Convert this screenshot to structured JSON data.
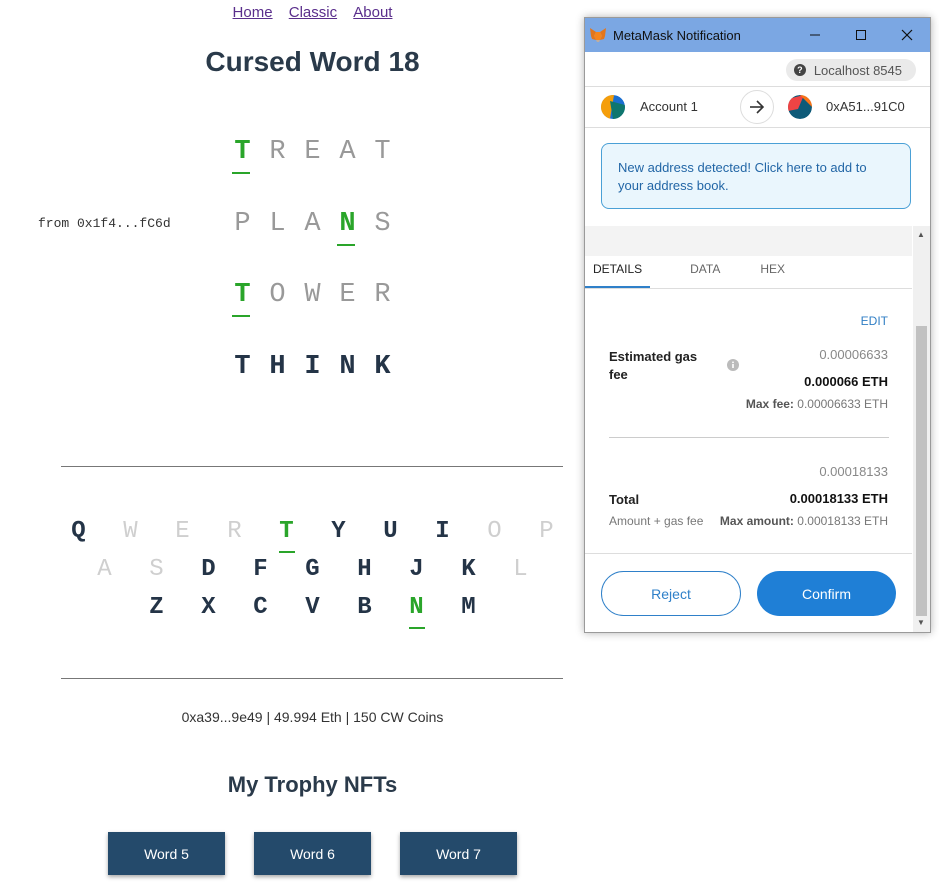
{
  "nav": {
    "home": "Home",
    "classic": "Classic",
    "about": "About"
  },
  "game": {
    "title": "Cursed Word 18",
    "from_label": "from 0x1f4...fC6d",
    "guesses": [
      [
        {
          "l": "T",
          "s": "green"
        },
        {
          "l": "R",
          "s": "gray"
        },
        {
          "l": "E",
          "s": "gray"
        },
        {
          "l": "A",
          "s": "gray"
        },
        {
          "l": "T",
          "s": "gray"
        }
      ],
      [
        {
          "l": "P",
          "s": "gray"
        },
        {
          "l": "L",
          "s": "gray"
        },
        {
          "l": "A",
          "s": "gray"
        },
        {
          "l": "N",
          "s": "green"
        },
        {
          "l": "S",
          "s": "gray"
        }
      ],
      [
        {
          "l": "T",
          "s": "green"
        },
        {
          "l": "O",
          "s": "gray"
        },
        {
          "l": "W",
          "s": "gray"
        },
        {
          "l": "E",
          "s": "gray"
        },
        {
          "l": "R",
          "s": "gray"
        }
      ],
      [
        {
          "l": "T",
          "s": "dark"
        },
        {
          "l": "H",
          "s": "dark"
        },
        {
          "l": "I",
          "s": "dark"
        },
        {
          "l": "N",
          "s": "dark"
        },
        {
          "l": "K",
          "s": "dark"
        }
      ]
    ]
  },
  "keyboard": {
    "rows": [
      [
        {
          "l": "Q",
          "s": "dark"
        },
        {
          "l": "W",
          "s": "gray"
        },
        {
          "l": "E",
          "s": "gray"
        },
        {
          "l": "R",
          "s": "gray"
        },
        {
          "l": "T",
          "s": "green"
        },
        {
          "l": "Y",
          "s": "dark"
        },
        {
          "l": "U",
          "s": "dark"
        },
        {
          "l": "I",
          "s": "dark"
        },
        {
          "l": "O",
          "s": "gray"
        },
        {
          "l": "P",
          "s": "gray"
        }
      ],
      [
        {
          "l": "A",
          "s": "gray"
        },
        {
          "l": "S",
          "s": "gray"
        },
        {
          "l": "D",
          "s": "dark"
        },
        {
          "l": "F",
          "s": "dark"
        },
        {
          "l": "G",
          "s": "dark"
        },
        {
          "l": "H",
          "s": "dark"
        },
        {
          "l": "J",
          "s": "dark"
        },
        {
          "l": "K",
          "s": "dark"
        },
        {
          "l": "L",
          "s": "gray"
        }
      ],
      [
        {
          "l": "Z",
          "s": "dark"
        },
        {
          "l": "X",
          "s": "dark"
        },
        {
          "l": "C",
          "s": "dark"
        },
        {
          "l": "V",
          "s": "dark"
        },
        {
          "l": "B",
          "s": "dark"
        },
        {
          "l": "N",
          "s": "green"
        },
        {
          "l": "M",
          "s": "dark"
        }
      ]
    ]
  },
  "status": "0xa39...9e49 | 49.994 Eth | 150 CW Coins",
  "trophies": {
    "title": "My Trophy NFTs",
    "items": [
      "Word 5",
      "Word 6",
      "Word 7"
    ]
  },
  "metamask": {
    "window_title": "MetaMask Notification",
    "network": "Localhost 8545",
    "from_account": "Account 1",
    "to_address": "0xA51...91C0",
    "notice": "New address detected! Click here to add to your address book.",
    "tabs": [
      "DETAILS",
      "DATA",
      "HEX"
    ],
    "edit": "EDIT",
    "gas": {
      "label": "Estimated gas fee",
      "value_gray": "0.00006633",
      "value_bold": "0.000066 ETH",
      "max_label": "Max fee:",
      "max_value": "0.00006633 ETH"
    },
    "total": {
      "label": "Total",
      "value_gray": "0.00018133",
      "value_bold": "0.00018133 ETH",
      "sub_label": "Amount + gas fee",
      "max_label": "Max amount:",
      "max_value": "0.00018133 ETH"
    },
    "reject": "Reject",
    "confirm": "Confirm"
  },
  "colors": {
    "green": "#2aa52a",
    "dark": "#243447",
    "button": "#244a6b",
    "mm_blue": "#1f7fd6",
    "titlebar": "#7ba7e3"
  }
}
